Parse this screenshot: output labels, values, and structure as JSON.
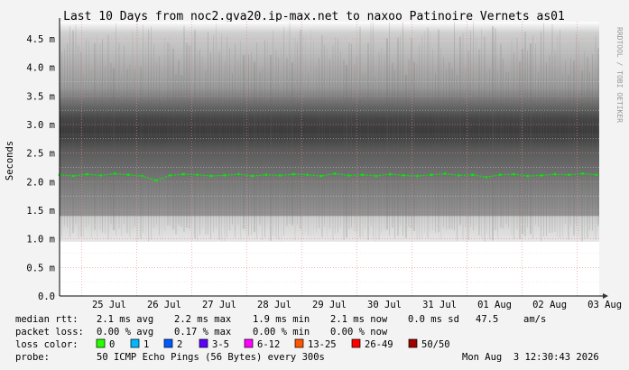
{
  "chart_data": {
    "type": "line",
    "title": "Last 10 Days from noc2.gva20.ip-max.net to naxoo_Patinoire_Vernets_as01",
    "ylabel": "Seconds",
    "watermark": "RRDTOOL / TOBI OETIKER",
    "y_ticks": [
      "0.0",
      "0.5 m",
      "1.0 m",
      "1.5 m",
      "2.0 m",
      "2.5 m",
      "3.0 m",
      "3.5 m",
      "4.0 m",
      "4.5 m"
    ],
    "y_tick_values": [
      0,
      0.5,
      1.0,
      1.5,
      2.0,
      2.5,
      3.0,
      3.5,
      4.0,
      4.5
    ],
    "ylim": [
      0,
      4.8
    ],
    "y_unit": "ms",
    "x_ticks": [
      "25 Jul",
      "26 Jul",
      "27 Jul",
      "28 Jul",
      "29 Jul",
      "30 Jul",
      "31 Jul",
      "01 Aug",
      "02 Aug",
      "03 Aug"
    ],
    "x_days_range": [
      0,
      9.8
    ],
    "grid": true,
    "series": [
      {
        "name": "median rtt",
        "color": "#00ee00",
        "x_days": [
          0.0,
          0.25,
          0.5,
          0.75,
          1.0,
          1.25,
          1.5,
          1.75,
          2.0,
          2.25,
          2.5,
          2.75,
          3.0,
          3.25,
          3.5,
          3.75,
          4.0,
          4.25,
          4.5,
          4.75,
          5.0,
          5.25,
          5.5,
          5.75,
          6.0,
          6.25,
          6.5,
          6.75,
          7.0,
          7.25,
          7.5,
          7.75,
          8.0,
          8.25,
          8.5,
          8.75,
          9.0,
          9.25,
          9.5,
          9.75
        ],
        "values_ms": [
          2.12,
          2.1,
          2.13,
          2.11,
          2.14,
          2.12,
          2.1,
          2.02,
          2.11,
          2.13,
          2.12,
          2.1,
          2.11,
          2.13,
          2.1,
          2.12,
          2.11,
          2.13,
          2.12,
          2.1,
          2.14,
          2.11,
          2.12,
          2.1,
          2.13,
          2.11,
          2.1,
          2.12,
          2.14,
          2.11,
          2.12,
          2.08,
          2.12,
          2.13,
          2.1,
          2.11,
          2.13,
          2.12,
          2.14,
          2.12
        ]
      }
    ],
    "smoke": {
      "type": "area",
      "name": "rtt spread",
      "inner_range_ms": [
        1.4,
        2.8
      ],
      "outer_range_ms": [
        0.95,
        4.8
      ]
    }
  },
  "legend": {
    "median_rtt": {
      "label": "median rtt:",
      "avg": "2.1 ms avg",
      "max": "2.2 ms max",
      "min": "1.9 ms min",
      "now": "2.1 ms now",
      "sd": "0.0 ms sd",
      "amps": "47.5",
      "amps_unit": "am/s"
    },
    "packet_loss": {
      "label": "packet loss:",
      "avg": "0.00 % avg",
      "max": "0.17 % max",
      "min": "0.00 % min",
      "now": "0.00 % now"
    },
    "loss_color": {
      "label": "loss color:",
      "items": [
        {
          "label": "0",
          "color": "#26ff00"
        },
        {
          "label": "1",
          "color": "#00b8ff"
        },
        {
          "label": "2",
          "color": "#0059ff"
        },
        {
          "label": "3-5",
          "color": "#5e00ff"
        },
        {
          "label": "6-12",
          "color": "#ff00ff"
        },
        {
          "label": "13-25",
          "color": "#ff5500"
        },
        {
          "label": "26-49",
          "color": "#ff0000"
        },
        {
          "label": "50/50",
          "color": "#a10000"
        }
      ]
    },
    "probe": {
      "label": "probe:",
      "text": "50 ICMP Echo Pings (56 Bytes) every 300s",
      "timestamp": "Mon Aug  3 12:30:43 2026"
    }
  }
}
